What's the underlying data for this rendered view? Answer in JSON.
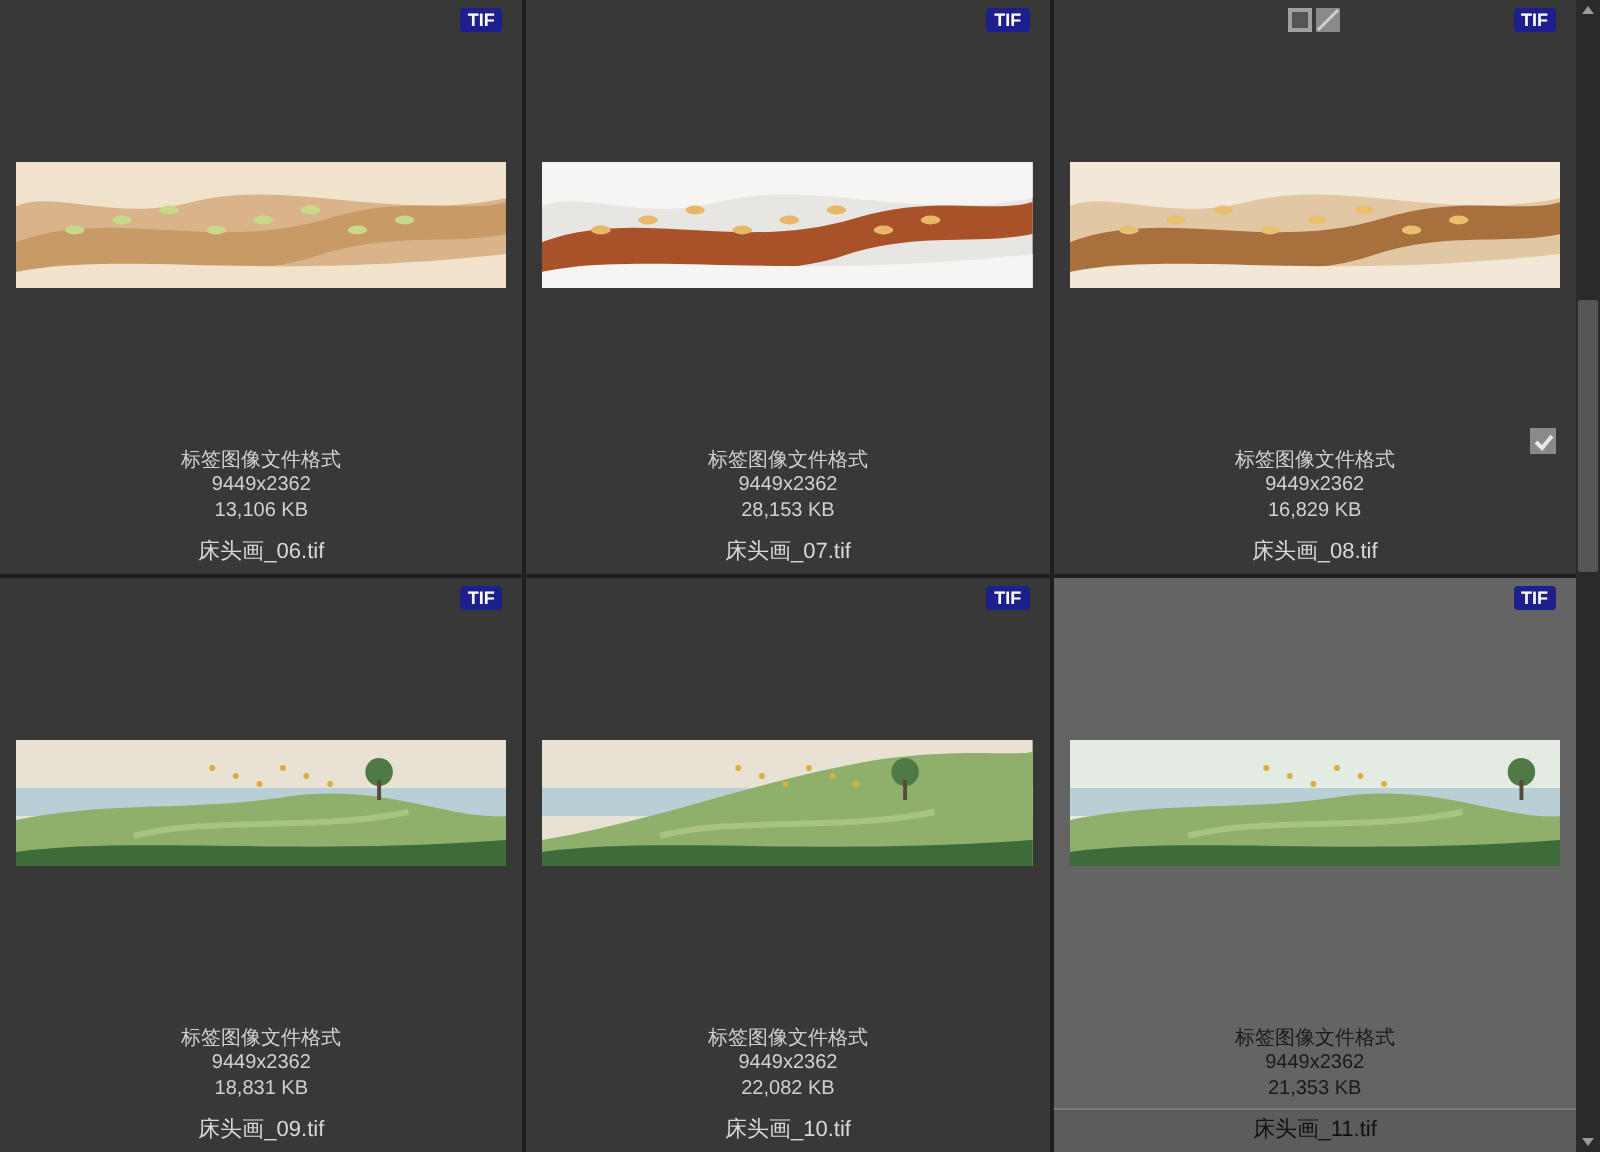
{
  "items": [
    {
      "badge": "TIF",
      "description": "标签图像文件格式",
      "dimensions": "9449x2362",
      "size": "13,106 KB",
      "name": "床头画_06.tif",
      "selected": false,
      "hovered": false
    },
    {
      "badge": "TIF",
      "description": "标签图像文件格式",
      "dimensions": "9449x2362",
      "size": "28,153 KB",
      "name": "床头画_07.tif",
      "selected": false,
      "hovered": false
    },
    {
      "badge": "TIF",
      "description": "标签图像文件格式",
      "dimensions": "9449x2362",
      "size": "16,829 KB",
      "name": "床头画_08.tif",
      "selected": false,
      "hovered": true,
      "checked": true
    },
    {
      "badge": "TIF",
      "description": "标签图像文件格式",
      "dimensions": "9449x2362",
      "size": "18,831 KB",
      "name": "床头画_09.tif",
      "selected": false,
      "hovered": false
    },
    {
      "badge": "TIF",
      "description": "标签图像文件格式",
      "dimensions": "9449x2362",
      "size": "22,082 KB",
      "name": "床头画_10.tif",
      "selected": false,
      "hovered": false
    },
    {
      "badge": "TIF",
      "description": "标签图像文件格式",
      "dimensions": "9449x2362",
      "size": "21,353 KB",
      "name": "床头画_11.tif",
      "selected": true,
      "hovered": false
    }
  ]
}
